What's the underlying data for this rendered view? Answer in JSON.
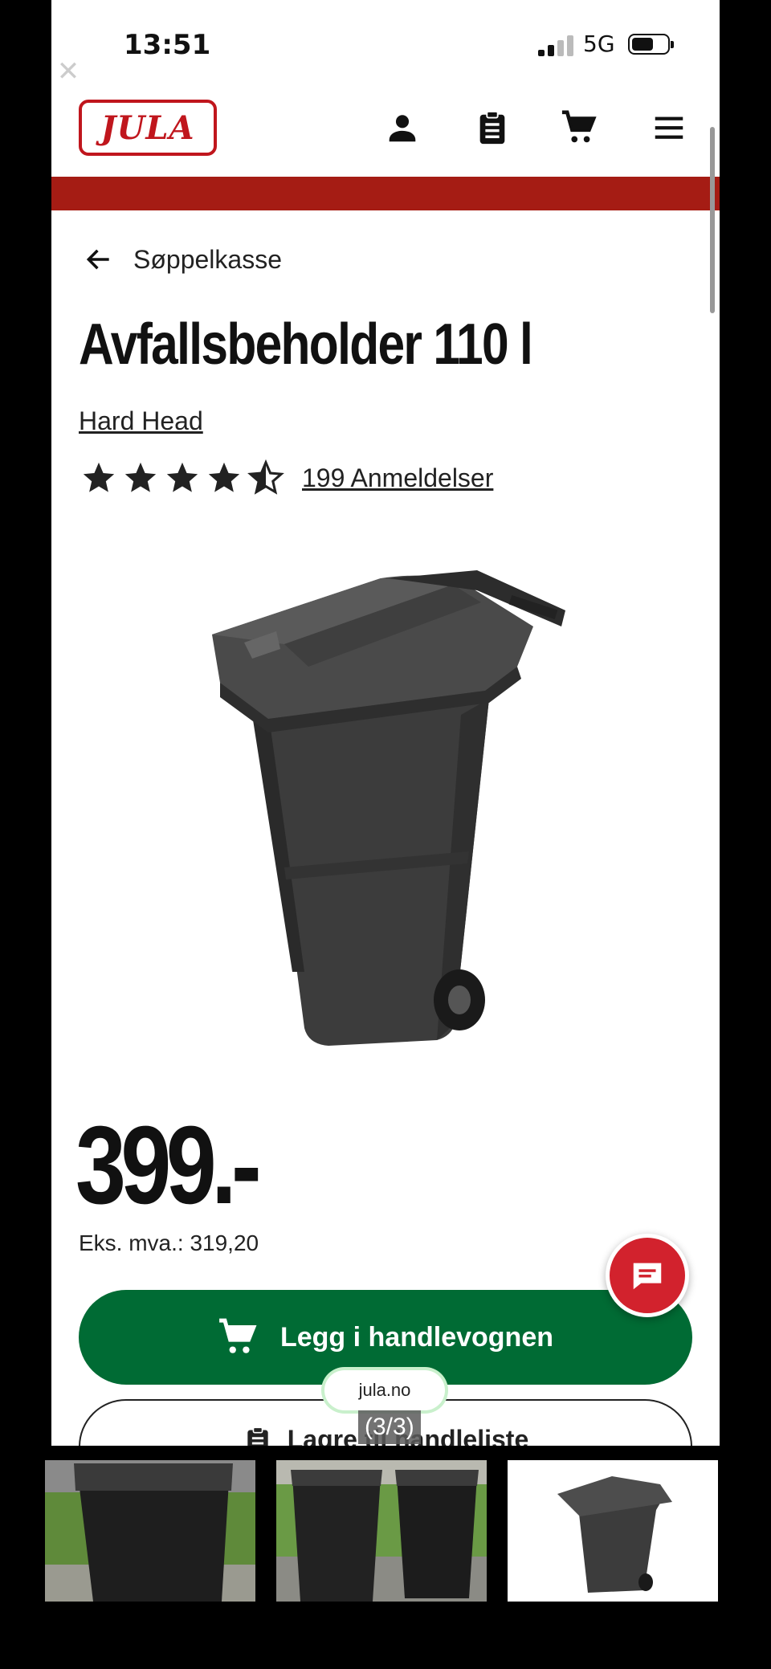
{
  "status_bar": {
    "time": "13:51",
    "network": "5G"
  },
  "header": {
    "logo_text": "JULA",
    "icons": [
      "user-icon",
      "shopping-list-icon",
      "cart-icon",
      "menu-icon"
    ]
  },
  "breadcrumb": {
    "label": "Søppelkasse"
  },
  "product": {
    "title": "Avfallsbeholder 110 l",
    "brand": "Hard Head",
    "rating": 4.5,
    "reviews_label": "199 Anmeldelser",
    "price": "399.-",
    "vat_label": "Eks. mva.: 319,20"
  },
  "actions": {
    "add_to_cart": "Legg i handlevognen",
    "save_list": "Lagre til handleliste"
  },
  "overlay": {
    "domain": "jula.no",
    "counter": "(3/3)"
  },
  "colors": {
    "brand_red": "#c0161d",
    "header_bar": "#a51c14",
    "cart_green": "#006b34",
    "chat_red": "#d2222d"
  }
}
